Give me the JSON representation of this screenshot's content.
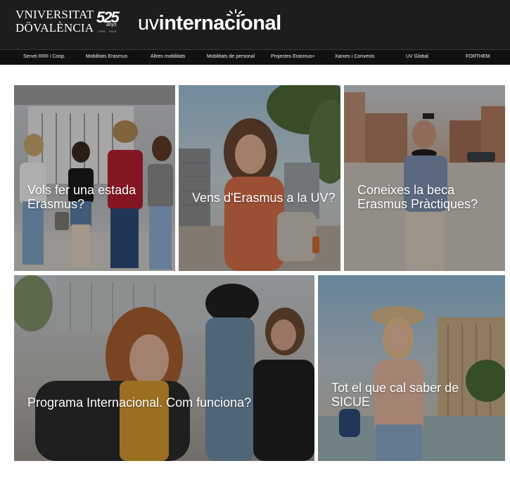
{
  "header": {
    "logo_line1": "VNIVERSITAT",
    "logo_line2": "DÖVALÈNCIA",
    "anniversary_number": "525",
    "anniversary_sub": "anys",
    "anniversary_years": "1499 · 2024",
    "brand_prefix": "uv",
    "brand_name": "internacional",
    "background_color": "#1d1d1d"
  },
  "nav": {
    "items": [
      {
        "label": "Servei RRII i Coop."
      },
      {
        "label": "Mobilitats Erasmus"
      },
      {
        "label": "Altres mobilitats"
      },
      {
        "label": "Mobilitats de personal"
      },
      {
        "label": "Projectes Erasmus+"
      },
      {
        "label": "Xarxes i Convenis"
      },
      {
        "label": "UV Global"
      },
      {
        "label": "FORTHEM"
      }
    ]
  },
  "cards": [
    {
      "caption": "Vols fer una estada Erasmus?"
    },
    {
      "caption": "Vens d'Erasmus a la UV?"
    },
    {
      "caption": "Coneixes la beca Erasmus Pràctiques?"
    },
    {
      "caption": "Programa Internacional. Com funciona?"
    },
    {
      "caption": "Tot el que cal saber de SICUE"
    }
  ]
}
